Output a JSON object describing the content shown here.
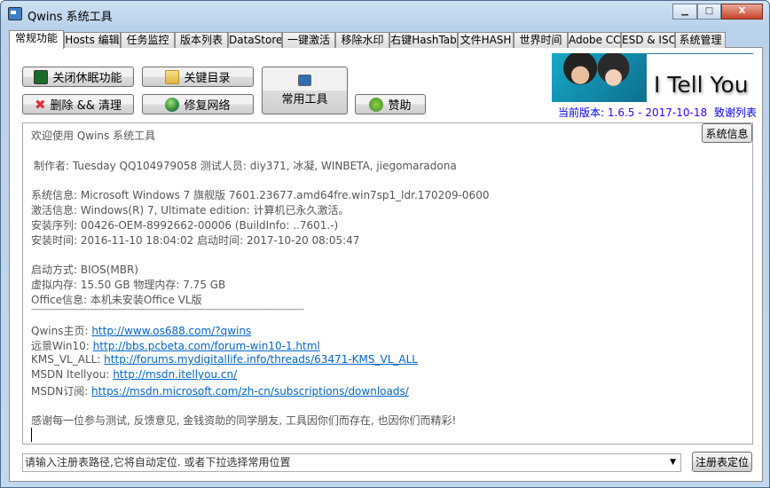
{
  "window": {
    "title": "Qwins 系统工具",
    "min": "▁",
    "max": "□",
    "close": "X"
  },
  "tabs": [
    "常规功能",
    "Hosts 编辑",
    "任务监控",
    "版本列表",
    "DataStore",
    "一键激活",
    "移除水印",
    "右键HashTab",
    "文件HASH",
    "世界时间",
    "Adobe CC",
    "ESD & ISO",
    "系统管理"
  ],
  "buttons": {
    "hibernate": "关闭休眠功能",
    "key_dirs": "关键目录",
    "delete_clean": "删除 && 清理",
    "repair_network": "修复网络",
    "common_tools": "常用工具",
    "donate": "赞助",
    "sysinfo": "系统信息",
    "reg_locate": "注册表定位"
  },
  "banner": {
    "logo_text": "I Tell You",
    "version_label": "当前版本:",
    "version": "1.6.5 - 2017-10-18",
    "thanks_link": "致谢列表"
  },
  "info": {
    "welcome": "欢迎使用 Qwins 系统工具",
    "author": "制作者: Tuesday QQ104979058 测试人员: diy371, 冰凝, WINBETA, jiegomaradona",
    "sys": "系统信息: Microsoft Windows 7 旗舰版  7601.23677.amd64fre.win7sp1_ldr.170209-0600",
    "activation": "激活信息: Windows(R) 7, Ultimate edition:  计算机已永久激活。",
    "serial": "安装序列: 00426-OEM-8992662-00006 (BuildInfo: ..7601.-)",
    "times": "安装时间: 2016-11-10 18:04:02 启动时间: 2017-10-20 08:05:47",
    "boot": "启动方式: BIOS(MBR)",
    "memory": "虚拟内存: 15.50 GB 物理内存: 7.75 GB",
    "office": "Office信息: 本机未安装Office VL版",
    "separator": "--------------------------------------------------------------------------------------------------------------------",
    "links": [
      {
        "label": "Qwins主页: ",
        "url": "http://www.os688.com/?qwins"
      },
      {
        "label": "远景Win10:  ",
        "url": "http://bbs.pcbeta.com/forum-win10-1.html"
      },
      {
        "label": "KMS_VL_ALL: ",
        "url": "http://forums.mydigitallife.info/threads/63471-KMS_VL_ALL"
      },
      {
        "label": "MSDN Itellyou: ",
        "url": "http://msdn.itellyou.cn/"
      },
      {
        "label": "MSDN订阅: ",
        "url": "https://msdn.microsoft.com/zh-cn/subscriptions/downloads/"
      }
    ],
    "thanks": "感谢每一位参与测试, 反馈意见, 金钱资助的同学朋友, 工具因你们而存在, 也因你们而精彩!"
  },
  "registry": {
    "placeholder": "请输入注册表路径,它将自动定位. 或者下拉选择常用位置",
    "arrow": "▼"
  }
}
